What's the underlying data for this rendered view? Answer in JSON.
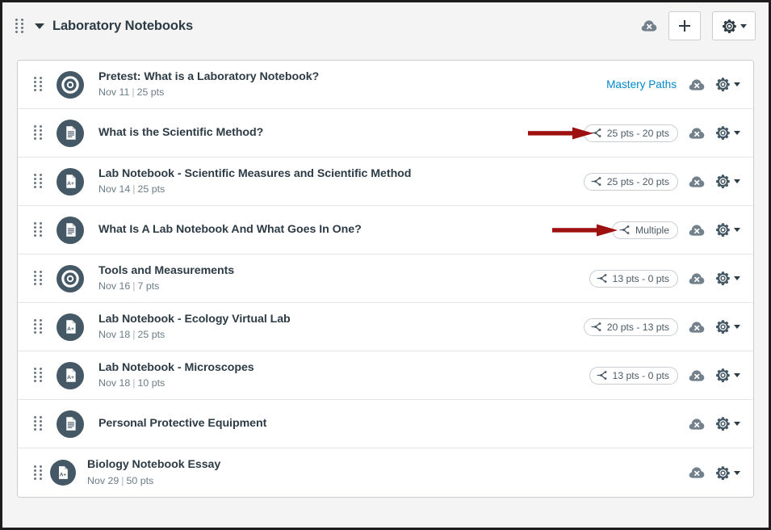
{
  "header": {
    "drag_handle": "drag-handle-icon",
    "collapse_caret": "chevron-down-icon",
    "title": "Laboratory Notebooks",
    "publish_icon": "cloud-unpublished-icon",
    "add_label": "+",
    "gear_label": "gear-icon"
  },
  "colors": {
    "accent_link": "#0088cc",
    "icon_circle": "#445865",
    "text_primary": "#2d3b45",
    "text_muted": "#6b7c86",
    "border": "#c7cdd1",
    "row_border": "#e4e7e9",
    "page_bg": "#f4f4f4",
    "arrow_red": "#9e0f0f",
    "unpublished_cloud": "#73818c"
  },
  "rows": [
    {
      "icon": "quiz-icon",
      "title": "Pretest: What is a Laboratory Notebook?",
      "date": "Nov 11",
      "points": "25 pts",
      "mastery_paths": "Mastery Paths",
      "pill": null,
      "arrow": false
    },
    {
      "icon": "page-icon",
      "title": "What is the Scientific Method?",
      "date": null,
      "points": null,
      "mastery_paths": null,
      "pill": "25 pts - 20 pts",
      "arrow": true
    },
    {
      "icon": "assignment-icon",
      "title": "Lab Notebook - Scientific Measures and Scientific Method",
      "date": "Nov 14",
      "points": "25 pts",
      "mastery_paths": null,
      "pill": "25 pts - 20 pts",
      "arrow": false
    },
    {
      "icon": "page-icon",
      "title": "What Is A Lab Notebook And What Goes In One?",
      "date": null,
      "points": null,
      "mastery_paths": null,
      "pill": "Multiple",
      "arrow": true
    },
    {
      "icon": "quiz-icon",
      "title": "Tools and Measurements",
      "date": "Nov 16",
      "points": "7 pts",
      "mastery_paths": null,
      "pill": "13 pts - 0 pts",
      "arrow": false
    },
    {
      "icon": "assignment-icon",
      "title": "Lab Notebook - Ecology Virtual Lab",
      "date": "Nov 18",
      "points": "25 pts",
      "mastery_paths": null,
      "pill": "20 pts - 13 pts",
      "arrow": false
    },
    {
      "icon": "assignment-icon",
      "title": "Lab Notebook - Microscopes",
      "date": "Nov 18",
      "points": "10 pts",
      "mastery_paths": null,
      "pill": "13 pts - 0 pts",
      "arrow": false
    },
    {
      "icon": "page-icon",
      "title": "Personal Protective Equipment",
      "date": null,
      "points": null,
      "mastery_paths": null,
      "pill": null,
      "arrow": false
    },
    {
      "icon": "assignment-icon",
      "title": "Biology Notebook Essay",
      "date": "Nov 29",
      "points": "50 pts",
      "mastery_paths": null,
      "pill": null,
      "arrow": false
    }
  ],
  "labels": {
    "meta_separator": "|",
    "pill_icon": "branch-differentiated-icon",
    "publish_icon": "cloud-unpublished-icon",
    "gear_icon": "gear-icon",
    "gear_caret": "chevron-down-icon"
  }
}
